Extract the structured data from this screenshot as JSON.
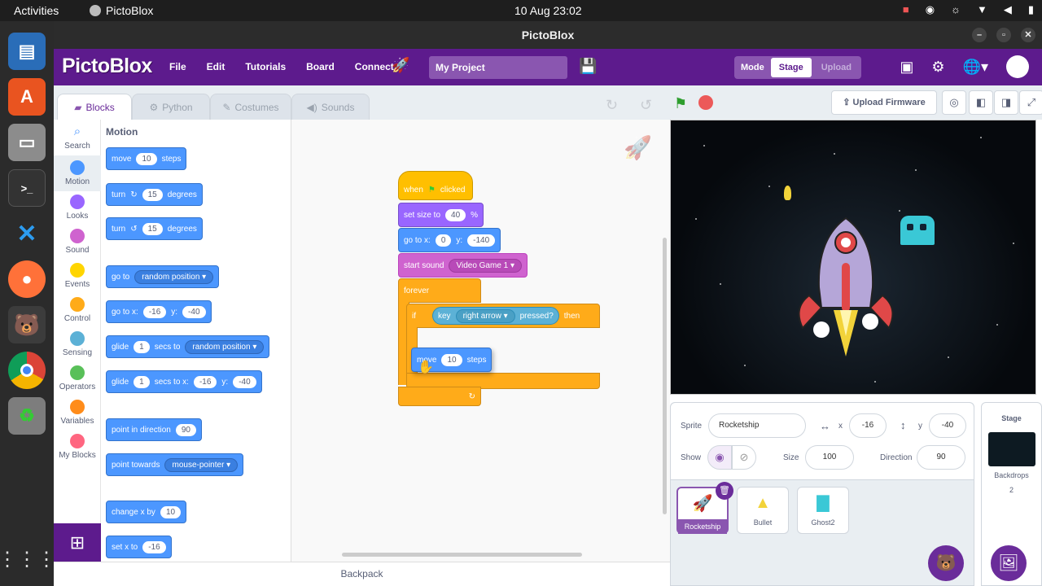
{
  "system": {
    "activities": "Activities",
    "app_name": "PictoBlox",
    "clock": "10 Aug  23:02"
  },
  "window": {
    "title": "PictoBlox"
  },
  "menubar": {
    "logo": "PictoBlox",
    "items": [
      "File",
      "Edit",
      "Tutorials",
      "Board",
      "Connect"
    ],
    "project_name": "My Project",
    "mode_label": "Mode",
    "mode_stage": "Stage",
    "mode_upload": "Upload"
  },
  "tabs": [
    "Blocks",
    "Python",
    "Costumes",
    "Sounds"
  ],
  "categories": [
    "Search",
    "Motion",
    "Looks",
    "Sound",
    "Events",
    "Control",
    "Sensing",
    "Operators",
    "Variables",
    "My Blocks"
  ],
  "category_colors": [
    "#ffffff",
    "#4c97ff",
    "#9966ff",
    "#cf63cf",
    "#ffd500",
    "#ffab19",
    "#5cb1d6",
    "#59c059",
    "#ff8c1a",
    "#ff6680"
  ],
  "palette": {
    "title": "Motion",
    "move": {
      "a": "move",
      "n": "10",
      "b": "steps"
    },
    "turn_right": {
      "a": "turn",
      "n": "15",
      "b": "degrees"
    },
    "turn_left": {
      "a": "turn",
      "n": "15",
      "b": "degrees"
    },
    "goto": {
      "a": "go to",
      "d": "random position"
    },
    "gotoxy": {
      "a": "go to x:",
      "x": "-16",
      "b": "y:",
      "y": "-40"
    },
    "glide": {
      "a": "glide",
      "n": "1",
      "b": "secs to",
      "d": "random position"
    },
    "glidexy": {
      "a": "glide",
      "n": "1",
      "b": "secs to x:",
      "x": "-16",
      "c": "y:",
      "y": "-40"
    },
    "direction": {
      "a": "point in direction",
      "n": "90"
    },
    "towards": {
      "a": "point towards",
      "d": "mouse-pointer"
    },
    "changex": {
      "a": "change x by",
      "n": "10"
    },
    "setx": {
      "a": "set x to",
      "n": "-16"
    }
  },
  "script": {
    "when": "when",
    "clicked": "clicked",
    "setsize": {
      "a": "set size to",
      "n": "40",
      "b": "%"
    },
    "gotoxy": {
      "a": "go to x:",
      "x": "0",
      "b": "y:",
      "y": "-140"
    },
    "sound": {
      "a": "start sound",
      "d": "Video Game 1"
    },
    "forever": "forever",
    "if": "if",
    "key": "key",
    "key_d": "right arrow",
    "pressed": "pressed?",
    "then": "then",
    "move": {
      "a": "move",
      "n": "10",
      "b": "steps"
    }
  },
  "backpack": "Backpack",
  "stage_head": {
    "upload_firmware": "Upload Firmware"
  },
  "sprite_info": {
    "sprite_label": "Sprite",
    "sprite_name": "Rocketship",
    "x_label": "x",
    "x": "-16",
    "y_label": "y",
    "y": "-40",
    "show_label": "Show",
    "size_label": "Size",
    "size": "100",
    "direction_label": "Direction",
    "direction": "90"
  },
  "sprites": [
    "Rocketship",
    "Bullet",
    "Ghost2"
  ],
  "stage_pane": {
    "title": "Stage",
    "backdrops_label": "Backdrops",
    "backdrops_count": "2"
  }
}
